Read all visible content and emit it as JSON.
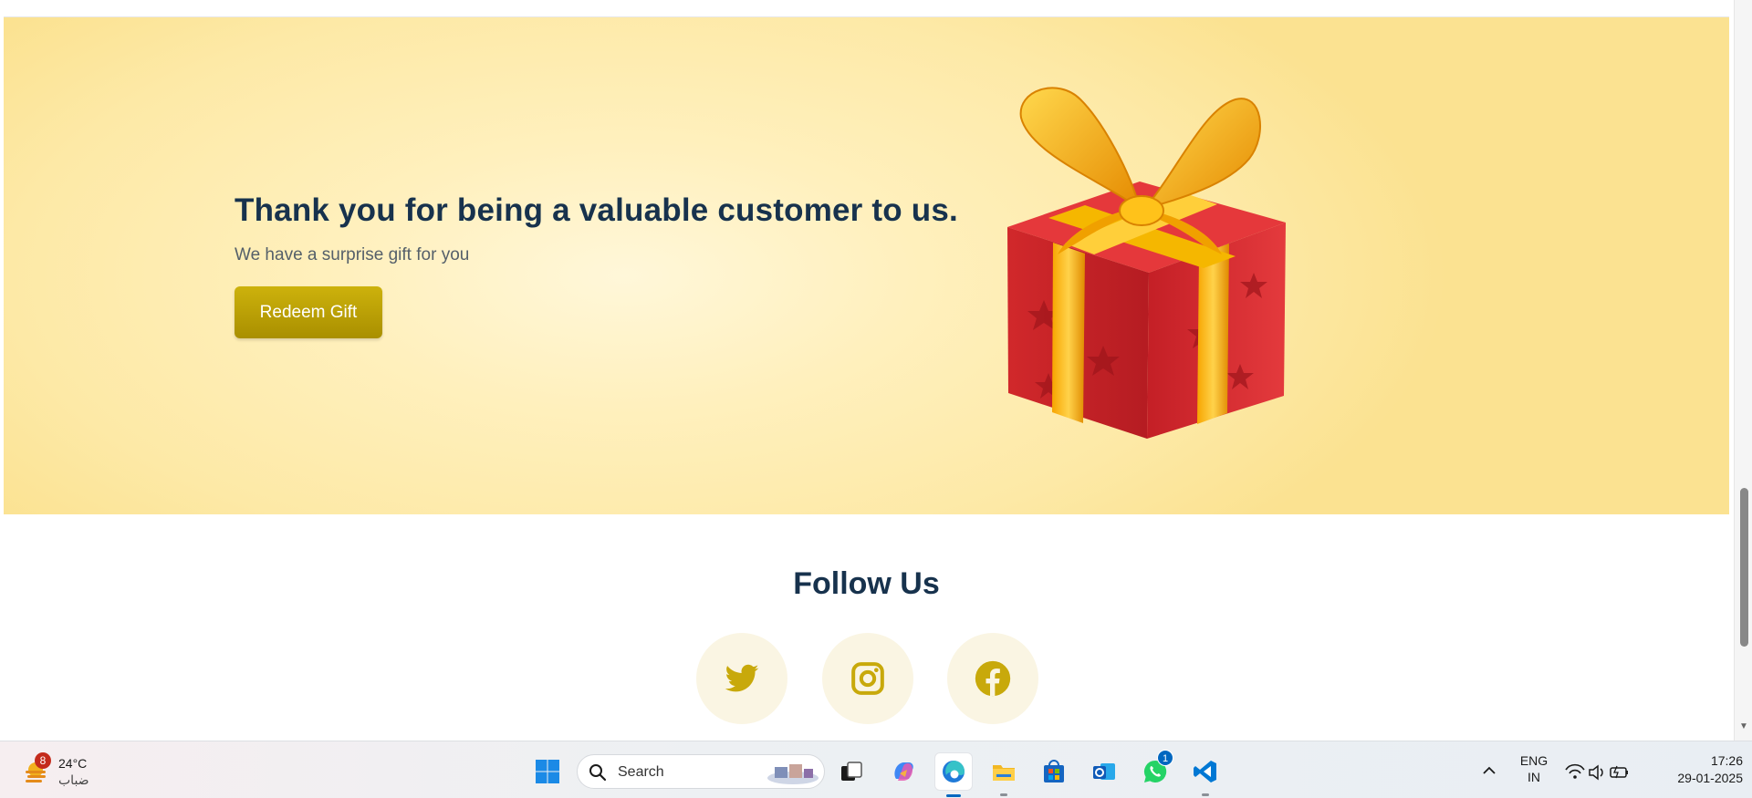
{
  "hero": {
    "title": "Thank you for being a valuable customer to us.",
    "subtitle": "We have a surprise gift for you",
    "button_label": "Redeem Gift",
    "gift_image": "gift-box-illustration"
  },
  "follow": {
    "title": "Follow Us",
    "socials": [
      {
        "name": "twitter-icon"
      },
      {
        "name": "instagram-icon"
      },
      {
        "name": "facebook-icon"
      }
    ],
    "icon_color": "#c8a90b"
  },
  "taskbar": {
    "weather": {
      "badge": "8",
      "temperature": "24°C",
      "condition": "ضباب"
    },
    "search_placeholder": "Search",
    "apps": [
      "windows-start-icon",
      "task-view-icon",
      "copilot-icon",
      "edge-icon",
      "file-explorer-icon",
      "microsoft-store-icon",
      "outlook-icon",
      "whatsapp-icon",
      "vscode-icon"
    ],
    "whatsapp_badge": "1",
    "language": {
      "line1": "ENG",
      "line2": "IN"
    },
    "clock": {
      "time": "17:26",
      "date": "29-01-2025"
    }
  },
  "colors": {
    "heading": "#17324d",
    "button": "#b89d05",
    "hero_background": "#fde9a6"
  }
}
